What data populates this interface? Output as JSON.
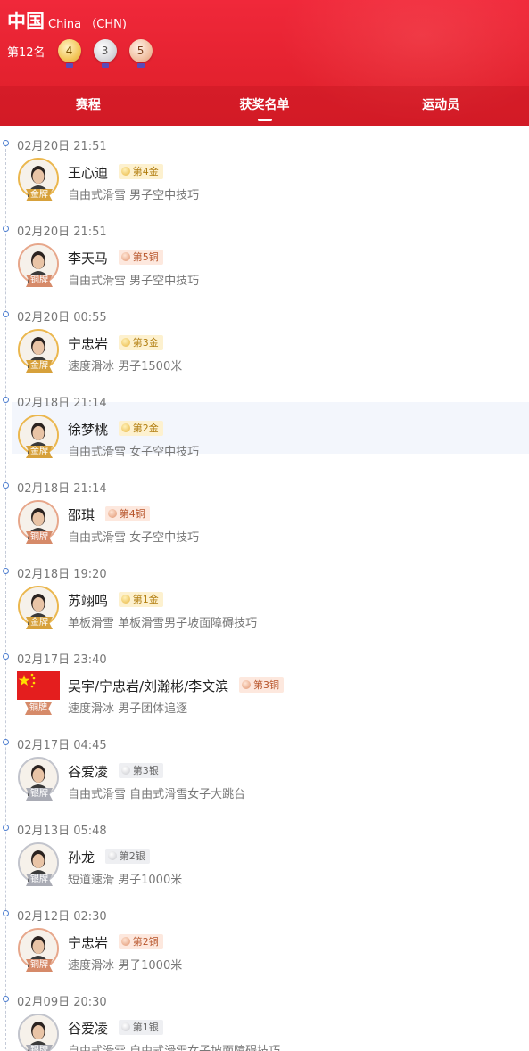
{
  "header": {
    "country_cn": "中国",
    "country_en": "China （CHN)",
    "rank": "第12名",
    "medals": {
      "gold": "4",
      "silver": "3",
      "bronze": "5"
    }
  },
  "tabs": [
    "赛程",
    "获奖名单",
    "运动员"
  ],
  "active_tab": "获奖名单",
  "entries": [
    {
      "time": "02月20日 21:51",
      "medal_type": "gold",
      "medal_label": "金牌",
      "name": "王心迪",
      "badge": "第4金",
      "event": "自由式滑雪 男子空中技巧"
    },
    {
      "time": "02月20日 21:51",
      "medal_type": "bronze",
      "medal_label": "铜牌",
      "name": "李天马",
      "badge": "第5铜",
      "event": "自由式滑雪 男子空中技巧"
    },
    {
      "time": "02月20日 00:55",
      "medal_type": "gold",
      "medal_label": "金牌",
      "name": "宁忠岩",
      "badge": "第3金",
      "event": "速度滑冰 男子1500米"
    },
    {
      "time": "02月18日 21:14",
      "medal_type": "gold",
      "medal_label": "金牌",
      "name": "徐梦桃",
      "badge": "第2金",
      "event": "自由式滑雪 女子空中技巧"
    },
    {
      "time": "02月18日 21:14",
      "medal_type": "bronze",
      "medal_label": "铜牌",
      "name": "邵琪",
      "badge": "第4铜",
      "event": "自由式滑雪 女子空中技巧"
    },
    {
      "time": "02月18日 19:20",
      "medal_type": "gold",
      "medal_label": "金牌",
      "name": "苏翊鸣",
      "badge": "第1金",
      "event": "单板滑雪 单板滑雪男子坡面障碍技巧"
    },
    {
      "time": "02月17日 23:40",
      "medal_type": "bronze",
      "medal_label": "铜牌",
      "name": "吴宇/宁忠岩/刘瀚彬/李文滨",
      "badge": "第3铜",
      "event": "速度滑冰 男子团体追逐",
      "flag": true
    },
    {
      "time": "02月17日 04:45",
      "medal_type": "silver",
      "medal_label": "银牌",
      "name": "谷爱凌",
      "badge": "第3银",
      "event": "自由式滑雪 自由式滑雪女子大跳台"
    },
    {
      "time": "02月13日 05:48",
      "medal_type": "silver",
      "medal_label": "银牌",
      "name": "孙龙",
      "badge": "第2银",
      "event": "短道速滑 男子1000米"
    },
    {
      "time": "02月12日 02:30",
      "medal_type": "bronze",
      "medal_label": "铜牌",
      "name": "宁忠岩",
      "badge": "第2铜",
      "event": "速度滑冰 男子1000米"
    },
    {
      "time": "02月09日 20:30",
      "medal_type": "silver",
      "medal_label": "银牌",
      "name": "谷爱凌",
      "badge": "第1银",
      "event": "自由式滑雪 自由式滑雪女子坡面障碍技巧"
    }
  ]
}
